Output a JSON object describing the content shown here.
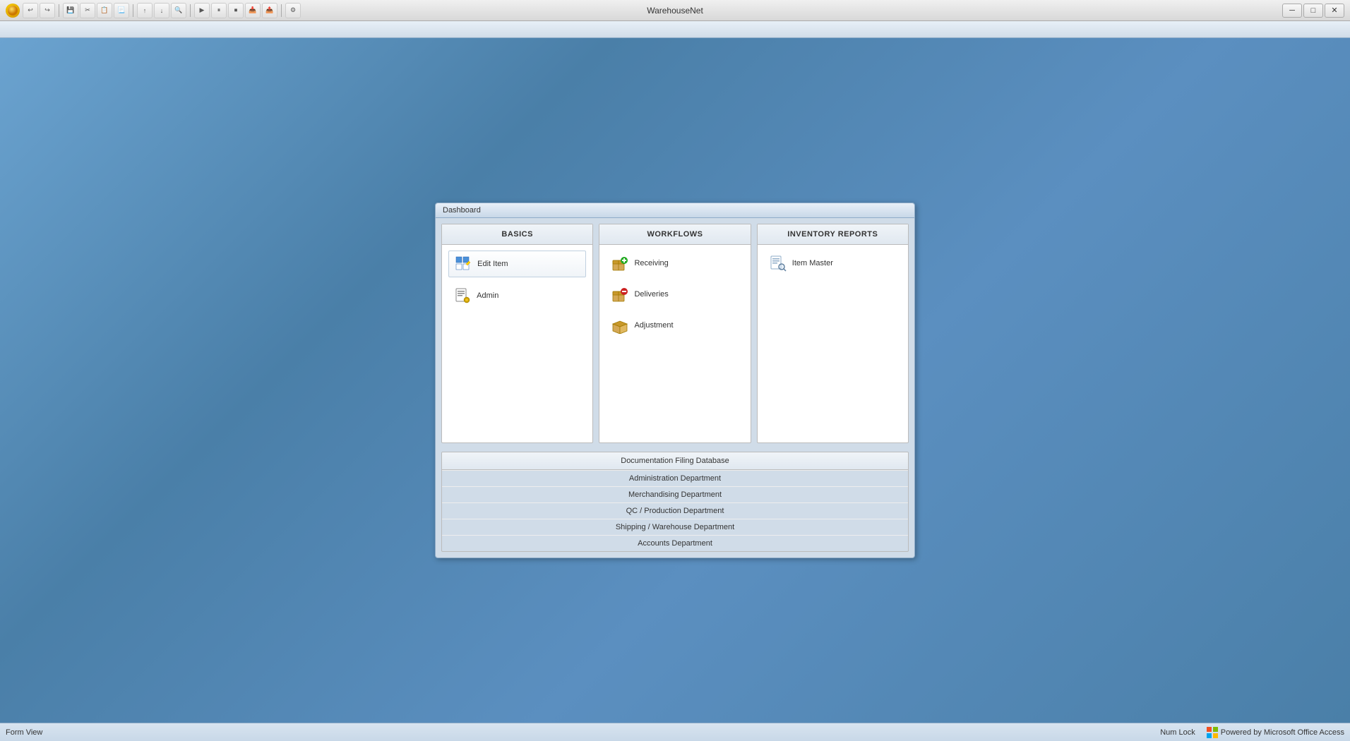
{
  "window": {
    "title": "WarehouseNet",
    "controls": {
      "minimize": "─",
      "maximize": "□",
      "close": "✕"
    }
  },
  "toolbar": {
    "buttons": [
      "↩",
      "↪",
      "💾",
      "✂",
      "📋",
      "📃",
      "↑",
      "↓",
      "🔍",
      "▶",
      "⏸",
      "⏹",
      "📥",
      "📤",
      "⚙"
    ]
  },
  "dashboard": {
    "title": "Dashboard",
    "columns": [
      {
        "id": "basics",
        "header": "BASICS",
        "items": [
          {
            "label": "Edit Item",
            "icon": "edit-item-icon"
          },
          {
            "label": "Admin",
            "icon": "admin-icon"
          }
        ]
      },
      {
        "id": "workflows",
        "header": "WORKFLOWS",
        "items": [
          {
            "label": "Receiving",
            "icon": "receiving-icon"
          },
          {
            "label": "Deliveries",
            "icon": "deliveries-icon"
          },
          {
            "label": "Adjustment",
            "icon": "adjustment-icon"
          }
        ]
      },
      {
        "id": "inventory",
        "header": "INVENTORY REPORTS",
        "items": [
          {
            "label": "Item Master",
            "icon": "item-master-icon"
          }
        ]
      }
    ],
    "filing": {
      "header": "Documentation Filing Database",
      "items": [
        "Administration Department",
        "Merchandising Department",
        "QC / Production Department",
        "Shipping / Warehouse Department",
        "Accounts Department"
      ]
    }
  },
  "statusbar": {
    "left": "Form View",
    "numlock": "Num Lock",
    "powered": "Powered by Microsoft Office Access"
  }
}
